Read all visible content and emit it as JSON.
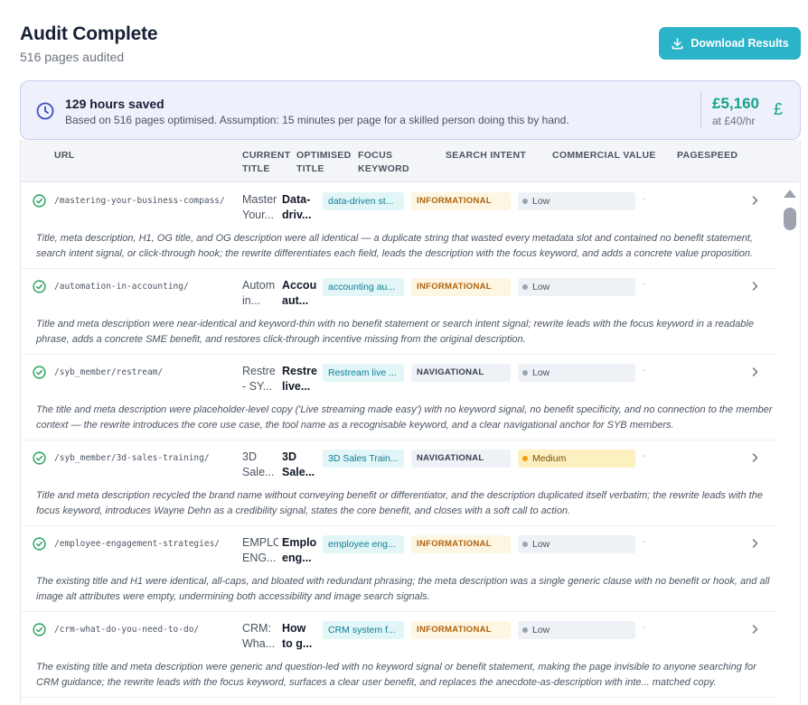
{
  "header": {
    "title": "Audit Complete",
    "subtitle": "516 pages audited",
    "download_label": "Download Results"
  },
  "summary": {
    "title": "129 hours saved",
    "description": "Based on 516 pages optimised. Assumption: 15 minutes per page for a skilled person doing this by hand.",
    "amount": "£5,160",
    "rate": "at £40/hr",
    "currency_symbol": "£"
  },
  "table": {
    "columns": {
      "url": "URL",
      "current_title_1": "CURRENT",
      "current_title_2": "TITLE",
      "optimised_title_1": "OPTIMISED",
      "optimised_title_2": "TITLE",
      "focus_keyword_1": "FOCUS",
      "focus_keyword_2": "KEYWORD",
      "search_intent": "SEARCH INTENT",
      "commercial_value": "COMMERCIAL VALUE",
      "pagespeed": "PAGESPEED"
    },
    "rows": [
      {
        "url": "/mastering-your-business-compass/",
        "current_title": "Master Your...",
        "optimised_title": "Data-driv...",
        "focus_keyword": "data-driven st...",
        "intent": "INFORMATIONAL",
        "commercial_value": "Low",
        "pagespeed": "-",
        "note": "Title, meta description, H1, OG title, and OG description were all identical — a duplicate string that wasted every metadata slot and contained no benefit statement, search intent signal, or click-through hook; the rewrite differentiates each field, leads the description with the focus keyword, and adds a concrete value proposition."
      },
      {
        "url": "/automation-in-accounting/",
        "current_title": "Autom in...",
        "optimised_title": "Accou aut...",
        "focus_keyword": "accounting au...",
        "intent": "INFORMATIONAL",
        "commercial_value": "Low",
        "pagespeed": "-",
        "note": "Title and meta description were near-identical and keyword-thin with no benefit statement or search intent signal; rewrite leads with the focus keyword in a readable phrase, adds a concrete SME benefit, and restores click-through incentive missing from the original description."
      },
      {
        "url": "/syb_member/restream/",
        "current_title": "Restre - SY...",
        "optimised_title": "Restre live...",
        "focus_keyword": "Restream live ...",
        "intent": "NAVIGATIONAL",
        "commercial_value": "Low",
        "pagespeed": "-",
        "note": "The title and meta description were placeholder-level copy ('Live streaming made easy') with no keyword signal, no benefit specificity, and no connection to the member context — the rewrite introduces the core use case, the tool name as a recognisable keyword, and a clear navigational anchor for SYB members."
      },
      {
        "url": "/syb_member/3d-sales-training/",
        "current_title": "3D Sale...",
        "optimised_title": "3D Sale...",
        "focus_keyword": "3D Sales Train...",
        "intent": "NAVIGATIONAL",
        "commercial_value": "Medium",
        "pagespeed": "-",
        "note": "Title and meta description recycled the brand name without conveying benefit or differentiator, and the description duplicated itself verbatim; the rewrite leads with the focus keyword, introduces Wayne Dehn as a credibility signal, states the core benefit, and closes with a soft call to action."
      },
      {
        "url": "/employee-engagement-strategies/",
        "current_title": "EMPLO ENG...",
        "optimised_title": "Emplo eng...",
        "focus_keyword": "employee eng...",
        "intent": "INFORMATIONAL",
        "commercial_value": "Low",
        "pagespeed": "-",
        "note": "The existing title and H1 were identical, all-caps, and bloated with redundant phrasing; the meta description was a single generic clause with no benefit or hook, and all image alt attributes were empty, undermining both accessibility and image search signals."
      },
      {
        "url": "/crm-what-do-you-need-to-do/",
        "current_title": "CRM: Wha...",
        "optimised_title": "How to g...",
        "focus_keyword": "CRM system f...",
        "intent": "INFORMATIONAL",
        "commercial_value": "Low",
        "pagespeed": "-",
        "note": "The existing title and meta description were generic and question-led with no keyword signal or benefit statement, making the page invisible to anyone searching for CRM guidance; the rewrite leads with the focus keyword, surfaces a clear user benefit, and replaces the anecdote-as-description with inte... matched copy."
      }
    ]
  },
  "colors": {
    "accent": "#2bb3c9",
    "savings_green": "#14a38b",
    "informational_text": "#b0620e",
    "medium_badge": "#fdf0c0"
  },
  "icons": {
    "download": "download-icon",
    "clock": "clock-icon",
    "row_status": "check-circle-icon",
    "row_expand": "chevron-right-icon"
  }
}
